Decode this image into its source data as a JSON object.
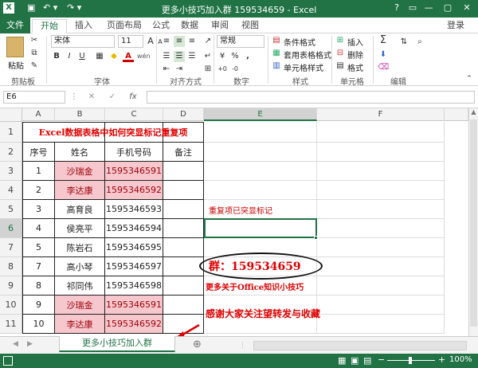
{
  "window": {
    "title": "更多小技巧加入群 159534659 - Excel",
    "qa_icons": [
      "excel-logo-icon",
      "save-icon",
      "undo-icon",
      "redo-icon"
    ],
    "controls": [
      "?",
      "▭",
      "—",
      "▢",
      "✕"
    ]
  },
  "tabs": {
    "file": "文件",
    "items": [
      "开始",
      "插入",
      "页面布局",
      "公式",
      "数据",
      "审阅",
      "视图"
    ],
    "active": "开始",
    "signin": "登录"
  },
  "ribbon": {
    "clipboard": {
      "paste": "粘贴",
      "label": "剪贴板"
    },
    "font": {
      "name": "宋体",
      "size": "11",
      "label": "字体",
      "bold": "B",
      "italic": "I",
      "underline": "U",
      "grow": "A",
      "shrink": "A",
      "color_letter": "A",
      "wen": "wén"
    },
    "alignment": {
      "label": "对齐方式"
    },
    "number": {
      "format": "常规",
      "label": "数字",
      "pct": "%",
      "comma": ","
    },
    "styles": {
      "cond": "条件格式",
      "table": "套用表格格式",
      "cell": "单元格样式",
      "label": "样式"
    },
    "cells": {
      "insert": "插入",
      "delete": "删除",
      "format": "格式",
      "label": "单元格"
    },
    "editing": {
      "sum": "Σ",
      "label": "编辑"
    }
  },
  "formula_bar": {
    "name_box": "E6",
    "fx": "fx",
    "value": ""
  },
  "columns": [
    "A",
    "B",
    "C",
    "D",
    "E",
    "F"
  ],
  "rows": [
    "1",
    "2",
    "3",
    "4",
    "5",
    "6",
    "7",
    "8",
    "9",
    "10",
    "11"
  ],
  "table": {
    "title": "Excel数据表格中如何突显标记重复项",
    "headers": [
      "序号",
      "姓名",
      "手机号码",
      "备注"
    ],
    "data": [
      {
        "no": "1",
        "name": "沙瑞金",
        "phone": "1595346591",
        "dup": true
      },
      {
        "no": "2",
        "name": "李达康",
        "phone": "1595346592",
        "dup": true
      },
      {
        "no": "3",
        "name": "高育良",
        "phone": "1595346593",
        "dup": false
      },
      {
        "no": "4",
        "name": "侯亮平",
        "phone": "1595346594",
        "dup": false
      },
      {
        "no": "5",
        "name": "陈岩石",
        "phone": "1595346595",
        "dup": false
      },
      {
        "no": "7",
        "name": "高小琴",
        "phone": "1595346597",
        "dup": false
      },
      {
        "no": "8",
        "name": "祁同伟",
        "phone": "1595346598",
        "dup": false
      },
      {
        "no": "9",
        "name": "沙瑞金",
        "phone": "1595346591",
        "dup": true
      },
      {
        "no": "10",
        "name": "李达康",
        "phone": "1595346592",
        "dup": true
      }
    ]
  },
  "annotations": {
    "note": "重复项已突显标记",
    "group": "群：159534659",
    "more": "更多关于Office知识小技巧",
    "thanks": "感谢大家关注望转发与收藏"
  },
  "sheet": {
    "tab": "更多小技巧加入群159534659",
    "add": "⊕"
  },
  "status": {
    "zoom": "100%",
    "minus": "−",
    "plus": "+"
  },
  "colors": {
    "accent": "#217346",
    "dup_fill": "#f7c7ce",
    "dup_text": "#9c0006",
    "annot_red": "#e00000"
  }
}
